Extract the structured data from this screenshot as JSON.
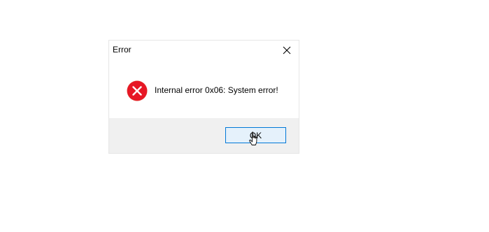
{
  "dialog": {
    "title": "Error",
    "close_icon": "close-icon",
    "error_icon": "error-x-icon",
    "message": "Internal error 0x06: System error!",
    "ok_label": "OK"
  },
  "colors": {
    "error_red": "#e81123",
    "button_border": "#0078d7",
    "footer_bg": "#f0f0f0"
  },
  "cursor": {
    "icon": "hand-pointer-icon"
  }
}
